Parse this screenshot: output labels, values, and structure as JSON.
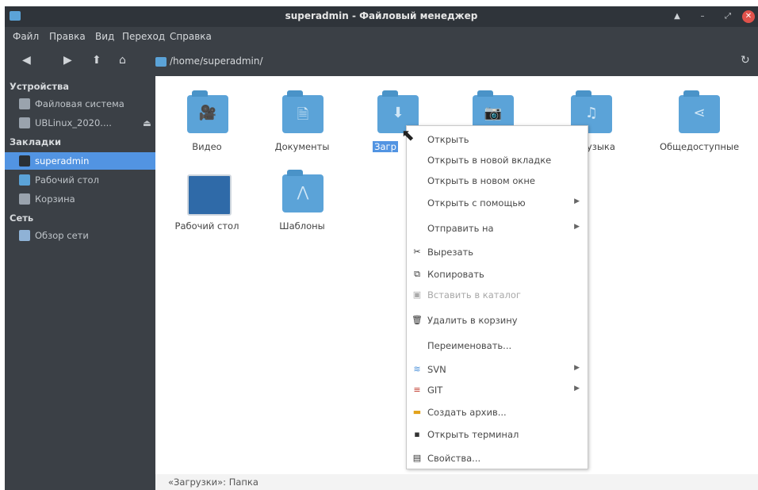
{
  "window": {
    "title": "superadmin - Файловый менеджер"
  },
  "menubar": {
    "items": [
      "Файл",
      "Правка",
      "Вид",
      "Переход",
      "Справка"
    ]
  },
  "toolbar": {
    "path": "/home/superadmin/"
  },
  "sidebar": {
    "devices_header": "Устройства",
    "devices": [
      "Файловая система",
      "UBLinux_2020...."
    ],
    "bookmarks_header": "Закладки",
    "bookmarks": [
      "superadmin",
      "Рабочий стол",
      "Корзина"
    ],
    "network_header": "Сеть",
    "network": [
      "Обзор сети"
    ]
  },
  "files": [
    "Видео",
    "Документы",
    "Загр",
    "",
    "Музыка",
    "Общедоступные",
    "Рабочий стол",
    "Шаблоны"
  ],
  "context_menu": {
    "items": [
      "Открыть",
      "Открыть в новой вкладке",
      "Открыть в новом окне",
      "Открыть с помощью",
      "Отправить на",
      "Вырезать",
      "Копировать",
      "Вставить в каталог",
      "Удалить в корзину",
      "Переименовать...",
      "SVN",
      "GIT",
      "Создать архив...",
      "Открыть терминал",
      "Свойства..."
    ]
  },
  "status": {
    "text": "«Загрузки»: Папка"
  },
  "icons": {
    "folder": "folder-icon",
    "app": "file-manager-icon"
  },
  "colors": {
    "accent": "#5294e2",
    "folder": "#5ba3d8"
  }
}
